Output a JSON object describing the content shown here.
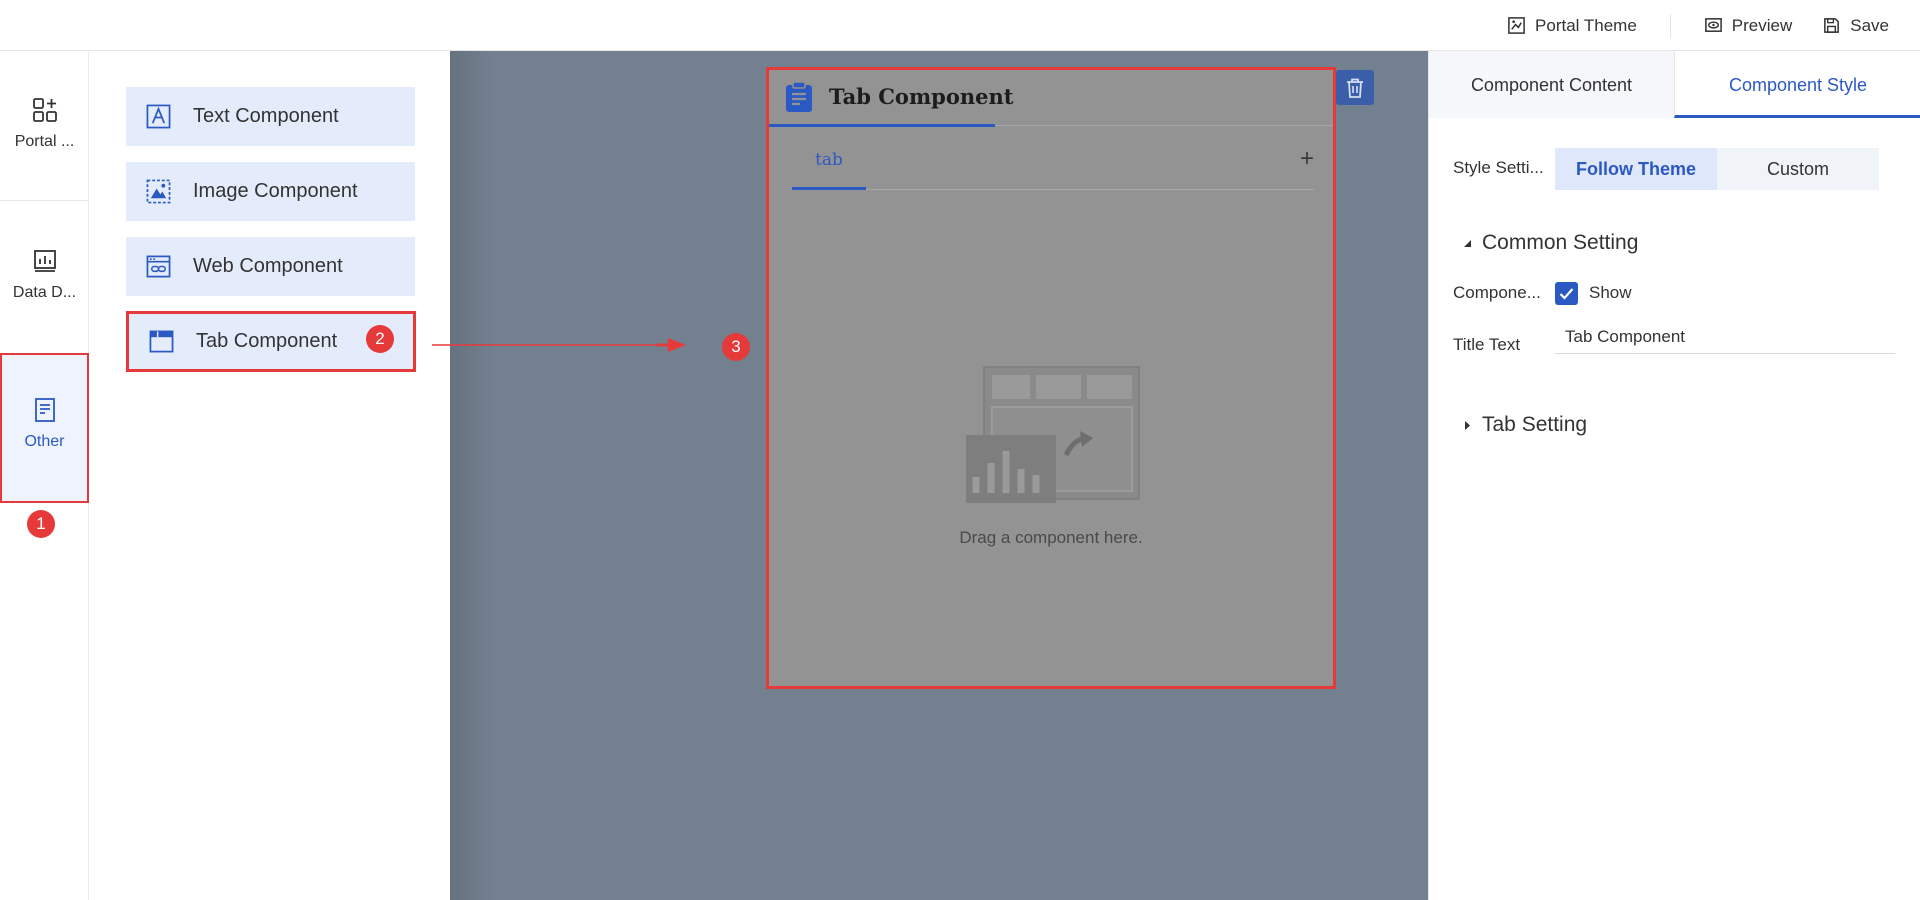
{
  "topbar": {
    "portal_theme": "Portal Theme",
    "preview": "Preview",
    "save": "Save"
  },
  "rail": {
    "items": [
      {
        "label": "Portal ...",
        "icon": "apps-add-icon"
      },
      {
        "label": "Data D...",
        "icon": "chart-board-icon"
      },
      {
        "label": "Other",
        "icon": "document-icon"
      }
    ]
  },
  "components": {
    "items": [
      {
        "label": "Text Component",
        "icon": "text-icon"
      },
      {
        "label": "Image Component",
        "icon": "image-icon"
      },
      {
        "label": "Web Component",
        "icon": "web-icon"
      },
      {
        "label": "Tab Component",
        "icon": "tab-icon"
      }
    ]
  },
  "annotations": {
    "step1": "1",
    "step2": "2",
    "step3": "3"
  },
  "canvas": {
    "card_title": "Tab Component",
    "tab_label": "tab",
    "add_tab": "+",
    "empty_text": "Drag a component here."
  },
  "right_panel": {
    "tabs": [
      "Component Content",
      "Component Style"
    ],
    "active_tab": "Component Style",
    "style_label": "Style Setti...",
    "style_options": [
      "Follow Theme",
      "Custom"
    ],
    "style_selected": "Follow Theme",
    "common_setting": "Common Setting",
    "component_label": "Compone...",
    "show_label": "Show",
    "show_checked": true,
    "title_text_label": "Title Text",
    "title_text_value": "Tab Component",
    "tab_setting": "Tab Setting"
  },
  "colors": {
    "accent": "#2b59c3",
    "highlight": "#e63a3a",
    "canvas_bg": "#728090",
    "component_btn_bg": "#e4ecfc"
  }
}
